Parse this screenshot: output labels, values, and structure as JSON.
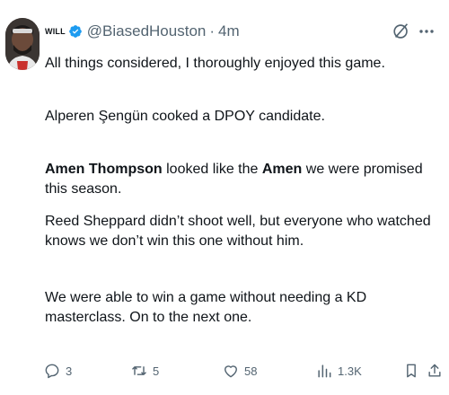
{
  "author": {
    "display_name": "WILL",
    "handle": "@BiasedHouston",
    "separator": "·",
    "time": "4m",
    "verified_color": "#1d9bf0"
  },
  "tweet": {
    "p1": "All things considered, I thoroughly enjoyed this game.",
    "p2": "Alperen Şengün cooked a DPOY candidate.",
    "p3_bold_1": "Amen Thompson",
    "p3_mid": " looked like the ",
    "p3_bold_2": "Amen",
    "p3_end": " we were promised this season.",
    "p4": "Reed Sheppard didn’t shoot well, but everyone who watched knows we don’t win this one without him.",
    "p5": "We were able to win a game without needing a KD masterclass. On to the next one."
  },
  "actions": {
    "replies": "3",
    "retweets": "5",
    "likes": "58",
    "views": "1.3K"
  },
  "icons": {
    "verified": "verified-badge-icon",
    "grok": "grok-icon",
    "more": "more-dots-icon",
    "reply": "reply-icon",
    "retweet": "retweet-icon",
    "like": "heart-icon",
    "views": "views-icon",
    "bookmark": "bookmark-icon",
    "share": "share-icon"
  },
  "colors": {
    "text": "#0f1419",
    "secondary": "#536471",
    "accent": "#1d9bf0"
  }
}
